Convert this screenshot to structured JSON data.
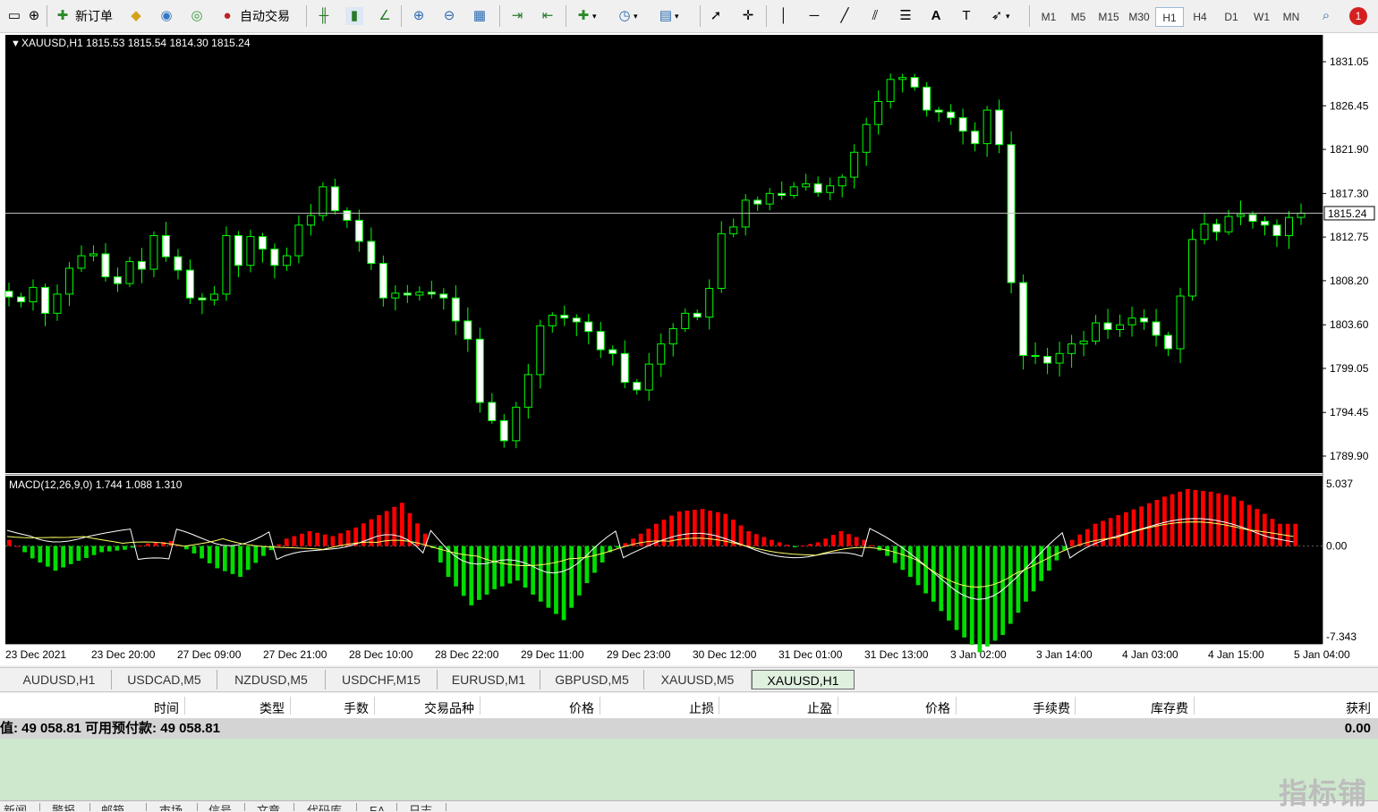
{
  "toolbar": {
    "new_order_label": "新订单",
    "auto_trade_label": "自动交易",
    "timeframes": [
      "M1",
      "M5",
      "M15",
      "M30",
      "H1",
      "H4",
      "D1",
      "W1",
      "MN"
    ],
    "active_timeframe": "H1",
    "notification_count": "1"
  },
  "chart": {
    "header": "XAUUSD,H1  1815.53 1815.54 1814.30 1815.24",
    "current_price": "1815.24",
    "price_ticks": [
      "1831.05",
      "1826.45",
      "1821.90",
      "1817.30",
      "1812.75",
      "1808.20",
      "1803.60",
      "1799.05",
      "1794.45",
      "1789.90"
    ],
    "macd_label": "MACD(12,26,9,0) 1.744 1.088 1.310",
    "macd_ticks": [
      "5.037",
      "0.00",
      "-7.343"
    ],
    "time_labels": [
      "23 Dec 2021",
      "23 Dec 20:00",
      "27 Dec 09:00",
      "27 Dec 21:00",
      "28 Dec 10:00",
      "28 Dec 22:00",
      "29 Dec 11:00",
      "29 Dec 23:00",
      "30 Dec 12:00",
      "31 Dec 01:00",
      "31 Dec 13:00",
      "3 Jan 02:00",
      "3 Jan 14:00",
      "4 Jan 03:00",
      "4 Jan 15:00",
      "5 Jan 04:00"
    ],
    "colors": {
      "bg": "#000000",
      "candle": "#00ff00",
      "bull_body": "#000000",
      "bear_body": "#ffffff",
      "macd_pos": "#ff0000",
      "macd_neg": "#00dd00",
      "signal": "#ffff66",
      "grid_line": "#c0c0c0"
    }
  },
  "chart_data": {
    "type": "candlestick",
    "symbol": "XAUUSD",
    "timeframe": "H1",
    "ylim": [
      1789.9,
      1831.05
    ],
    "close_path": [
      1806.5,
      1806.0,
      1807.5,
      1804.8,
      1806.8,
      1809.5,
      1810.8,
      1811.0,
      1808.6,
      1807.9,
      1810.2,
      1809.4,
      1812.9,
      1810.7,
      1809.3,
      1806.4,
      1806.2,
      1806.8,
      1812.9,
      1809.8,
      1812.8,
      1811.5,
      1809.8,
      1810.8,
      1814.0,
      1815.0,
      1818.0,
      1815.5,
      1814.5,
      1812.3,
      1810.0,
      1806.4,
      1806.9,
      1806.7,
      1807.0,
      1806.8,
      1806.4,
      1804.0,
      1802.1,
      1795.5,
      1793.6,
      1791.5,
      1795.0,
      1798.4,
      1803.5,
      1804.6,
      1804.3,
      1803.9,
      1802.9,
      1801.0,
      1800.6,
      1797.6,
      1796.8,
      1799.5,
      1801.6,
      1803.2,
      1804.8,
      1804.4,
      1807.4,
      1813.1,
      1813.8,
      1816.6,
      1816.2,
      1817.3,
      1817.1,
      1818.0,
      1818.3,
      1817.4,
      1818.1,
      1819.0,
      1821.6,
      1824.5,
      1826.9,
      1829.2,
      1829.4,
      1828.4,
      1826.0,
      1825.8,
      1825.2,
      1823.8,
      1822.5,
      1826.0,
      1822.4,
      1808.0,
      1800.4,
      1800.3,
      1799.6,
      1800.6,
      1801.6,
      1801.9,
      1803.8,
      1803.1,
      1803.6,
      1804.3,
      1803.9,
      1802.5,
      1801.1,
      1806.6,
      1812.5,
      1814.1,
      1813.3,
      1814.9,
      1815.1,
      1814.4,
      1814.0,
      1812.9,
      1814.8,
      1815.24
    ],
    "macd_histogram": [
      0.5,
      -1.0,
      -2.0,
      -1.2,
      -0.5,
      -0.3,
      0.2,
      0.4,
      -0.6,
      -1.8,
      -2.5,
      -0.8,
      0.6,
      1.2,
      0.8,
      1.5,
      2.5,
      3.5,
      1.0,
      -2.5,
      -4.8,
      -3.5,
      -2.8,
      -4.5,
      -6.0,
      -3.0,
      -0.5,
      0.6,
      1.8,
      2.8,
      3.0,
      2.6,
      1.2,
      0.5,
      -0.1,
      0.3,
      1.2,
      0.5,
      -0.8,
      -2.5,
      -4.5,
      -6.8,
      -8.6,
      -7.2,
      -4.5,
      -2.0,
      0.5,
      1.8,
      2.5,
      3.2,
      4.0,
      4.6,
      4.4,
      4.0,
      3.0,
      1.8
    ],
    "macd_ylim": [
      -7.343,
      5.037
    ],
    "price_ticks": [
      1831.05,
      1826.45,
      1821.9,
      1817.3,
      1812.75,
      1808.2,
      1803.6,
      1799.05,
      1794.45,
      1789.9
    ],
    "last": 1815.24,
    "ohlc_last": {
      "open": 1815.53,
      "high": 1815.54,
      "low": 1814.3,
      "close": 1815.24
    },
    "macd": {
      "fast": 12,
      "slow": 26,
      "signal": 9,
      "values": [
        1.744,
        1.088,
        1.31
      ]
    }
  },
  "symbol_tabs": [
    "AUDUSD,H1",
    "USDCAD,M5",
    "NZDUSD,M5",
    "USDCHF,M15",
    "EURUSD,M1",
    "GBPUSD,M5",
    "XAUUSD,M5",
    "XAUUSD,H1"
  ],
  "active_symbol_tab": "XAUUSD,H1",
  "terminal": {
    "columns": [
      "时间",
      "类型",
      "手数",
      "交易品种",
      "价格",
      "止损",
      "止盈",
      "价格",
      "手续费",
      "库存费",
      "获利"
    ],
    "balance_text": "值: 49 058.81  可用预付款: 49 058.81",
    "profit_total": "0.00"
  },
  "bottom_tabs": [
    "新闻",
    "警报",
    "邮箱",
    "市场",
    "信号",
    "文章",
    "代码库",
    "EA",
    "日志"
  ],
  "watermark": "指标铺"
}
